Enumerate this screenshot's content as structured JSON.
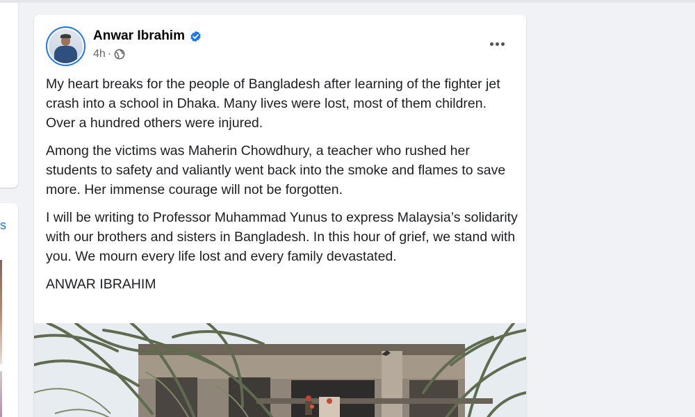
{
  "post": {
    "author": "Anwar Ibrahim",
    "verified": true,
    "time": "4h",
    "separator": "·",
    "privacy_icon": "globe-icon",
    "more_icon": "more-options-icon",
    "paragraphs": [
      "My heart breaks for the people of Bangladesh after learning of the fighter jet crash into a school in Dhaka. Many lives were lost, most of them children. Over a hundred others were injured.",
      "Among the victims was Maherin Chowdhury, a teacher who rushed her students to safety and valiantly went back into the smoke and flames to save more. Her immense courage will not be forgotten.",
      "I will be writing to Professor Muhammad Yunus to express Malaysia’s solidarity with our brothers and sisters in Bangladesh. In this hour of grief, we stand with you. We mourn every life lost and every family devastated."
    ],
    "signature": "ANWAR IBRAHIM"
  },
  "left_panel": {
    "partial_text": "s"
  },
  "colors": {
    "accent": "#1877f2",
    "page_bg": "#f0f2f5",
    "secondary_text": "#65676b"
  }
}
